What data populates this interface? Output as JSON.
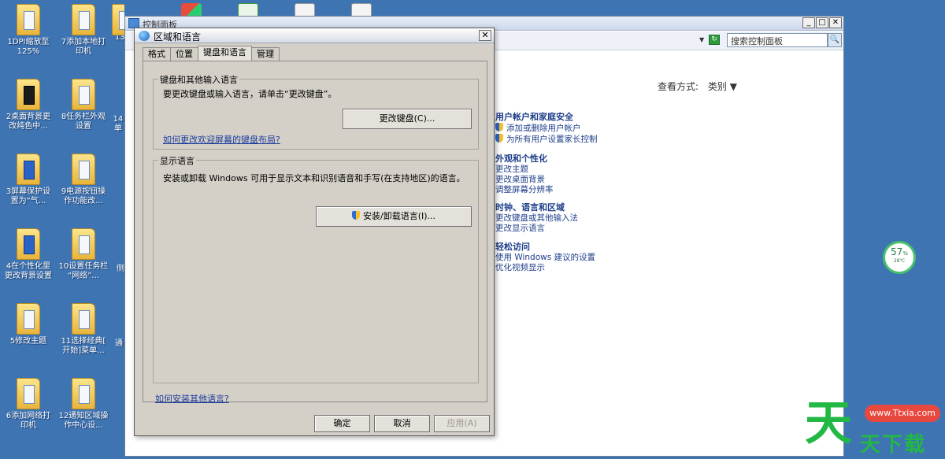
{
  "desktop": {
    "icons": [
      {
        "label": "1DPI缩放至\n125%"
      },
      {
        "label": "7添加本地打\n印机"
      },
      {
        "label": "13"
      },
      {
        "label": "2桌面背景更\n改纯色中..."
      },
      {
        "label": "8任务栏外观\n设置"
      },
      {
        "label": "14\n单"
      },
      {
        "label": "3屏幕保护设\n置为“气..."
      },
      {
        "label": "9电源按钮操\n作功能改..."
      },
      {
        "label": "4在个性化里\n更改背景设置"
      },
      {
        "label": "10设置任务栏\n“网络”..."
      },
      {
        "label": "侧"
      },
      {
        "label": "5修改主题"
      },
      {
        "label": "11选择经典[\n开始]菜单..."
      },
      {
        "label": "通"
      },
      {
        "label": "6添加网络打\n印机"
      },
      {
        "label": "12通知区域操\n作中心设..."
      }
    ]
  },
  "control_panel": {
    "title": "控制面板",
    "search_placeholder": "搜索控制面板",
    "view_label": "查看方式:",
    "view_value": "类别",
    "categories": [
      {
        "title": "用户帐户和家庭安全",
        "links": [
          "添加或删除用户帐户",
          "为所有用户设置家长控制"
        ]
      },
      {
        "title": "外观和个性化",
        "links": [
          "更改主题",
          "更改桌面背景",
          "调整屏幕分辨率"
        ]
      },
      {
        "title": "时钟、语言和区域",
        "links": [
          "更改键盘或其他输入法",
          "更改显示语言"
        ]
      },
      {
        "title": "轻松访问",
        "links": [
          "使用 Windows 建议的设置",
          "优化视频显示"
        ]
      }
    ]
  },
  "dialog": {
    "title": "区域和语言",
    "tabs": [
      "格式",
      "位置",
      "键盘和语言",
      "管理"
    ],
    "keyboard_group": {
      "label": "键盘和其他输入语言",
      "text": "要更改键盘或输入语言，请单击“更改键盘”。",
      "button": "更改键盘(C)...",
      "link": "如何更改欢迎屏幕的键盘布局?"
    },
    "display_group": {
      "label": "显示语言",
      "text": "安装或卸载 Windows 可用于显示文本和识别语音和手写(在支持地区)的语言。",
      "button": "安装/卸载语言(I)..."
    },
    "bottom_link": "如何安装其他语言?",
    "ok": "确定",
    "cancel": "取消",
    "apply": "应用(A)"
  },
  "gauge": {
    "percent": "57",
    "unit": "%",
    "temp": "28℃"
  },
  "watermark": {
    "big": "天",
    "rest": "天下载",
    "url": "www.Ttxia.com"
  },
  "colors": {
    "desktop": "#3f74b3",
    "link": "#1e3e8a",
    "dialog": "#d4d0c8",
    "gauge": "#47c16b",
    "watermark": "#22b845"
  }
}
